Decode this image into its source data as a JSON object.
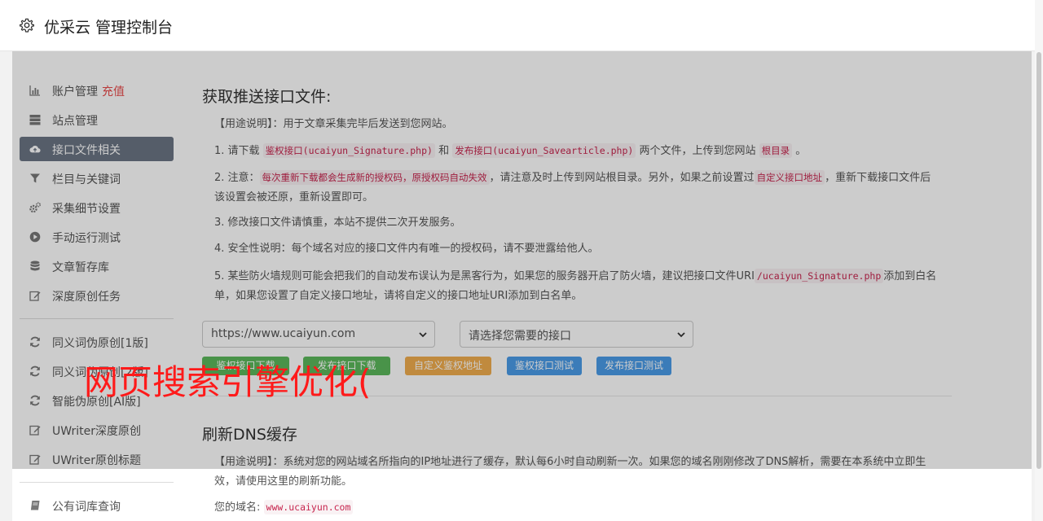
{
  "header": {
    "title": "优采云 管理控制台",
    "icon": "gear-icon"
  },
  "sidebar": {
    "items": [
      {
        "label": "账户管理",
        "extra": "充值",
        "icon": "bar-chart-icon"
      },
      {
        "label": "站点管理",
        "icon": "server-icon"
      },
      {
        "label": "接口文件相关",
        "icon": "cloud-upload-icon",
        "active": true
      },
      {
        "label": "栏目与关键词",
        "icon": "filter-icon"
      },
      {
        "label": "采集细节设置",
        "icon": "cogs-icon"
      },
      {
        "label": "手动运行测试",
        "icon": "play-circle-icon"
      },
      {
        "label": "文章暂存库",
        "icon": "database-icon"
      },
      {
        "label": "深度原创任务",
        "icon": "edit-icon"
      },
      {
        "label": "同义词伪原创[1版]",
        "icon": "refresh-icon"
      },
      {
        "label": "同义词伪原创[2版]",
        "icon": "refresh-icon"
      },
      {
        "label": "智能伪原创[AI版]",
        "icon": "refresh-icon"
      },
      {
        "label": "UWriter深度原创",
        "icon": "edit-icon"
      },
      {
        "label": "UWriter原创标题",
        "icon": "edit-icon"
      },
      {
        "label": "公有词库查询",
        "icon": "book-icon"
      }
    ]
  },
  "main": {
    "section1": {
      "title": "获取推送接口文件:",
      "usage": "【用途说明】：用于文章采集完毕后发送到您网站。",
      "step1": {
        "pre": "1. 请下载",
        "code1": "鉴权接口(ucaiyun_Signature.php)",
        "and": "和",
        "code2": "发布接口(ucaiyun_Savearticle.php)",
        "mid": "两个文件，上传到您网站",
        "code3": "根目录",
        "end": "。"
      },
      "step2": {
        "pre": "2. 注意：",
        "code1": "每次重新下载都会生成新的授权码，原授权码自动失效",
        "mid": "，请注意及时上传到网站根目录。另外，如果之前设置过",
        "code2": "自定义接口地址",
        "end": "，重新下载接口文件后该设置会被还原，重新设置即可。"
      },
      "step3": "3. 修改接口文件请慎重，本站不提供二次开发服务。",
      "step4": "4. 安全性说明：每个域名对应的接口文件内有唯一的授权码，请不要泄露给他人。",
      "step5": {
        "pre": "5. 某些防火墙规则可能会把我们的自动发布误认为是黑客行为，如果您的服务器开启了防火墙，建议把接口文件URI",
        "code1": "/ucaiyun_Signature.php",
        "end": "添加到白名单，如果您设置了自定义接口地址，请将自定义的接口地址URI添加到白名单。"
      },
      "site_select": "https://www.ucaiyun.com",
      "interface_select": "请选择您需要的接口",
      "buttons": {
        "download_sig": "鉴权接口下载",
        "download_save": "发布接口下载",
        "custom": "自定义鉴权地址",
        "test_sig": "鉴权接口测试",
        "test_save": "发布接口测试"
      }
    },
    "section2": {
      "title": "刷新DNS缓存",
      "usage": "【用途说明】：系统对您的网站域名所指向的IP地址进行了缓存，默认每6小时自动刷新一次。如果您的域名刚刚修改了DNS解析，需要在本系统中立即生效，请使用这里的刷新功能。",
      "domain_label": "您的域名:",
      "domain_value": "www.ucaiyun.com"
    }
  },
  "watermark": "网页搜索引擎优化(",
  "colors": {
    "active_menu": "#6b7584",
    "recharge": "#e84a4a",
    "watermark": "#ff1a1a",
    "code": "#c7254e"
  }
}
